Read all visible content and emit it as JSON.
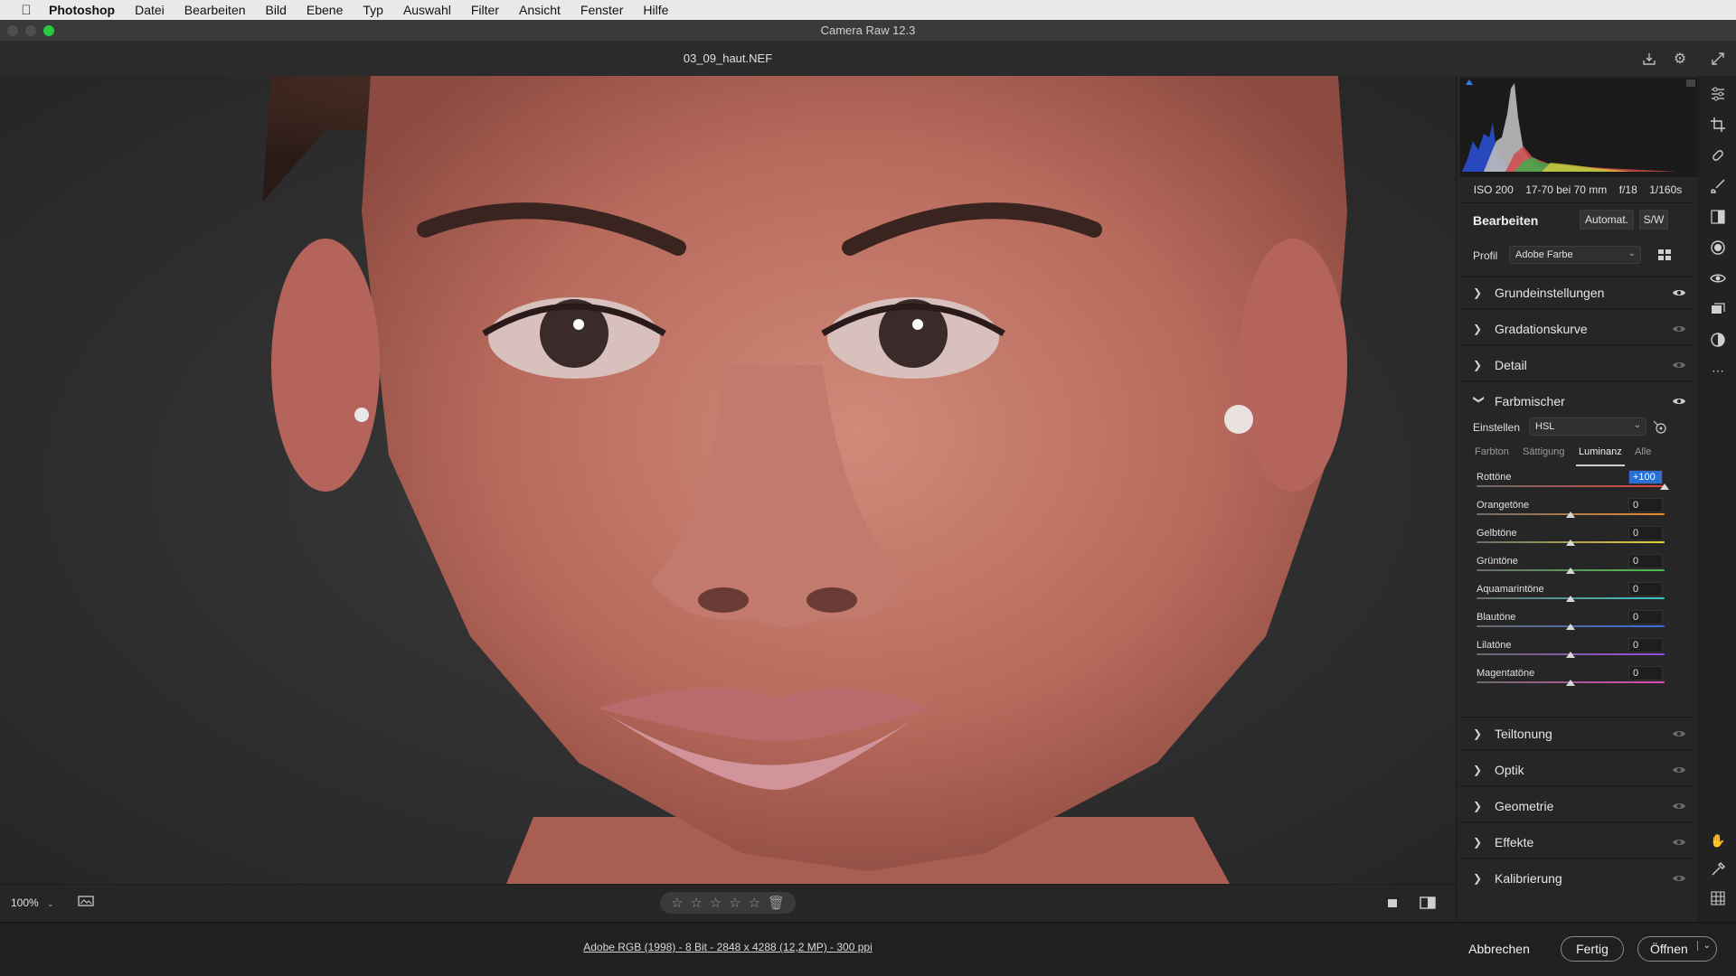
{
  "menubar": {
    "items": [
      "Photoshop",
      "Datei",
      "Bearbeiten",
      "Bild",
      "Ebene",
      "Typ",
      "Auswahl",
      "Filter",
      "Ansicht",
      "Fenster",
      "Hilfe"
    ]
  },
  "window": {
    "title": "Camera Raw 12.3"
  },
  "file": {
    "name": "03_09_haut.NEF"
  },
  "exif": {
    "iso": "ISO 200",
    "lens": "17-70 bei 70 mm",
    "aperture": "f/18",
    "shutter": "1/160s"
  },
  "edit": {
    "title": "Bearbeiten",
    "auto_label": "Automat.",
    "bw_label": "S/W",
    "profile_label": "Profil",
    "profile_value": "Adobe Farbe"
  },
  "sections_top": [
    {
      "label": "Grundeinstellungen",
      "expanded": false
    },
    {
      "label": "Gradationskurve",
      "expanded": false
    },
    {
      "label": "Detail",
      "expanded": false
    },
    {
      "label": "Farbmischer",
      "expanded": true
    }
  ],
  "mixer": {
    "einstellen_label": "Einstellen",
    "einstellen_value": "HSL",
    "tabs": [
      "Farbton",
      "Sättigung",
      "Luminanz",
      "Alle"
    ],
    "active_tab": "Luminanz",
    "sliders": [
      {
        "label": "Rottöne",
        "value": "+100",
        "pos": 1.0,
        "colors": [
          "#6b6b6b",
          "#e0453a"
        ]
      },
      {
        "label": "Orangetöne",
        "value": "0",
        "pos": 0.5,
        "colors": [
          "#6b6b6b",
          "#f08a2a"
        ]
      },
      {
        "label": "Gelbtöne",
        "value": "0",
        "pos": 0.5,
        "colors": [
          "#6b6b6b",
          "#e6d23a"
        ]
      },
      {
        "label": "Grüntöne",
        "value": "0",
        "pos": 0.5,
        "colors": [
          "#6b6b6b",
          "#4cc04c"
        ]
      },
      {
        "label": "Aquamarintöne",
        "value": "0",
        "pos": 0.5,
        "colors": [
          "#6b6b6b",
          "#3ac6c6"
        ]
      },
      {
        "label": "Blautöne",
        "value": "0",
        "pos": 0.5,
        "colors": [
          "#6b6b6b",
          "#3a6ee6"
        ]
      },
      {
        "label": "Lilatöne",
        "value": "0",
        "pos": 0.5,
        "colors": [
          "#6b6b6b",
          "#9a4ae6"
        ]
      },
      {
        "label": "Magentatöne",
        "value": "0",
        "pos": 0.5,
        "colors": [
          "#6b6b6b",
          "#e04ab8"
        ]
      }
    ]
  },
  "sections_bottom": [
    {
      "label": "Teiltonung"
    },
    {
      "label": "Optik"
    },
    {
      "label": "Geometrie"
    },
    {
      "label": "Effekte"
    },
    {
      "label": "Kalibrierung"
    }
  ],
  "status": {
    "zoom": "100%"
  },
  "footer": {
    "file_info": "Adobe RGB (1998) - 8 Bit - 2848 x 4288 (12,2 MP) - 300 ppi",
    "cancel": "Abbrechen",
    "done": "Fertig",
    "open": "Öffnen"
  },
  "icons": {
    "tools": [
      "sliders-icon",
      "crop-icon",
      "healing-brush-icon",
      "brush-icon",
      "gradient-icon",
      "radial-filter-icon",
      "redeye-icon",
      "snapshots-icon",
      "presets-icon",
      "more-icon"
    ],
    "bottom_tools": [
      "hand-icon",
      "color-sampler-icon",
      "grid-icon"
    ]
  }
}
